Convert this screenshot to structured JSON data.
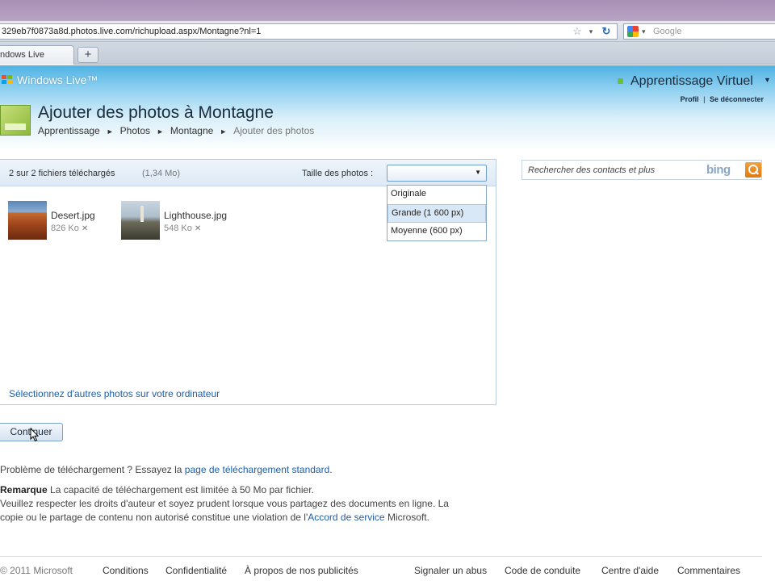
{
  "browser": {
    "url": "329eb7f0873a8d.photos.live.com/richupload.aspx/Montagne?nl=1",
    "search_placeholder": "Google",
    "tab_label": "ndows Live",
    "new_tab": "+"
  },
  "header": {
    "logo": "Windows Live™",
    "user_name": "Apprentissage Virtuel",
    "links": [
      "Profil",
      "Se déconnecter"
    ],
    "link_sep": "|"
  },
  "page": {
    "title": "Ajouter des photos à Montagne",
    "breadcrumb": [
      "Apprentissage",
      "Photos",
      "Montagne"
    ],
    "breadcrumb_current": "Ajouter des photos"
  },
  "upload": {
    "count": "2 sur 2 fichiers téléchargés",
    "total_size": "(1,34 Mo)",
    "size_label": "Taille des photos :",
    "size_options": [
      "Originale",
      "Grande (1 600 px)",
      "Moyenne (600 px)"
    ],
    "files": [
      {
        "name": "Desert.jpg",
        "size": "826 Ko"
      },
      {
        "name": "Lighthouse.jpg",
        "size": "548 Ko"
      }
    ],
    "select_more": "Sélectionnez d'autres photos sur votre ordinateur"
  },
  "actions": {
    "continue": "Continuer"
  },
  "notes": {
    "problem_prefix": "Problème de téléchargement ? Essayez la ",
    "problem_link": "page de téléchargement standard",
    "problem_suffix": ".",
    "remark_label": "Remarque",
    "remark_1": "  La capacité de téléchargement est limitée à 50 Mo par fichier.",
    "remark_2": "Veuillez respecter les droits d'auteur et soyez prudent lorsque vous partagez des documents en ligne. La",
    "remark_3_prefix": "copie ou le partage de contenu non autorisé constitue une violation de l'",
    "remark_3_link": "Accord de service",
    "remark_3_suffix": " Microsoft."
  },
  "side_search": {
    "placeholder": "Rechercher des contacts et plus",
    "logo": "bing"
  },
  "footer": {
    "copyright": "© 2011 Microsoft",
    "links": [
      "Conditions",
      "Confidentialité",
      "À propos de nos publicités"
    ],
    "right_links": [
      "Signaler un abus",
      "Code de conduite",
      "Centre d'aide",
      "Commentaires"
    ]
  }
}
